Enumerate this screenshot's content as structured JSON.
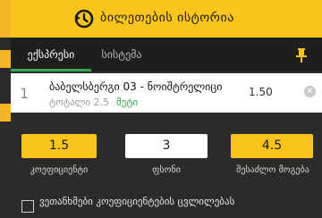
{
  "header": {
    "title": "ბილეთების ისტორია",
    "icon": "history-icon"
  },
  "tabs": [
    {
      "label": "ექსპრესი",
      "active": true
    },
    {
      "label": "სისტემა",
      "active": false
    }
  ],
  "bet": {
    "index": "1",
    "name": "ბაბელსბერგი 03 - ნოიშტრელიცი",
    "market": "ტოტალი 2.5",
    "selection": "მეტი",
    "odds": "1.50"
  },
  "summary": {
    "coefficient_value": "1.5",
    "coefficient_label": "კოეფიციენტი",
    "stake_value": "3",
    "stake_label": "ფსონი",
    "payout_value": "4.5",
    "payout_label": "შესაძლო მოგება"
  },
  "accept_changes": {
    "label": "ვეთანხმები კოეფიციენტების ცვლილებას",
    "checked": false
  },
  "colors": {
    "accent": "#f9c51d",
    "active_tab_underline": "#2fa84f",
    "background": "#2b2b2b"
  }
}
